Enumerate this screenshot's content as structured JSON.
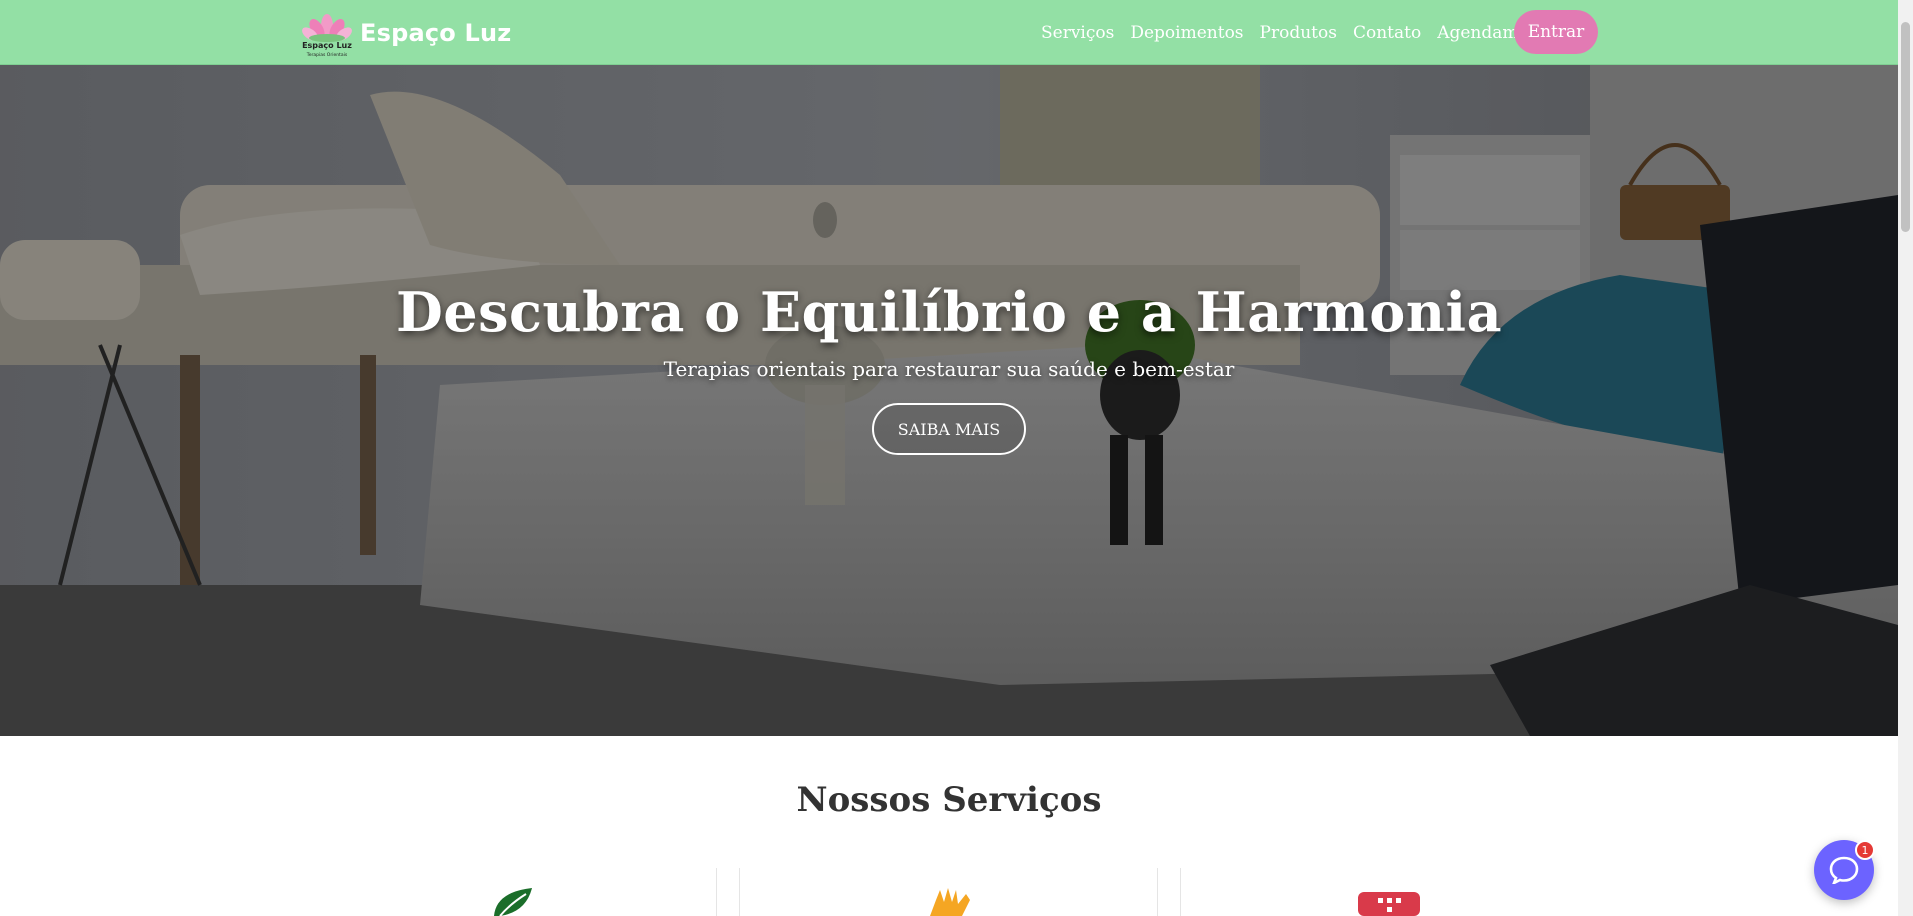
{
  "brand": {
    "name": "Espaço Luz",
    "logo_top": "Espaço Luz",
    "logo_bottom": "Terapias Orientais"
  },
  "nav": {
    "links": [
      "Serviços",
      "Depoimentos",
      "Produtos",
      "Contato",
      "Agendamentos"
    ],
    "login_label": "Entrar"
  },
  "hero": {
    "title": "Descubra o Equilíbrio e a Harmonia",
    "subtitle": "Terapias orientais para restaurar sua saúde e bem-estar",
    "cta_label": "SAIBA MAIS"
  },
  "services": {
    "title": "Nossos Serviços",
    "icons": [
      "leaf-icon",
      "hands-icon",
      "calendar-icon"
    ]
  },
  "chat": {
    "badge_count": "1"
  },
  "colors": {
    "navbar": "#93e0a5",
    "login_button": "#e27ab3",
    "chat": "#6c63ff",
    "badge": "#e53935",
    "leaf": "#1b6e2a",
    "hands": "#f5a623",
    "calendar": "#d93a4a"
  }
}
